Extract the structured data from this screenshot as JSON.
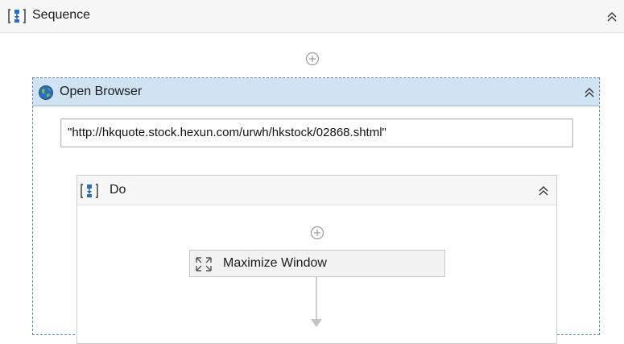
{
  "sequence": {
    "title": "Sequence",
    "icon": "sequence-icon"
  },
  "open_browser": {
    "title": "Open Browser",
    "icon": "globe-icon",
    "url_value": "\"http://hkquote.stock.hexun.com/urwh/hkstock/02868.shtml\""
  },
  "do_block": {
    "title": "Do",
    "icon": "sequence-icon"
  },
  "maximize_window": {
    "title": "Maximize Window",
    "icon": "maximize-icon"
  },
  "colors": {
    "header_blue": "#cfe3f3",
    "dashed_border": "#5a86b5",
    "icon_blue": "#2a6ebd"
  }
}
